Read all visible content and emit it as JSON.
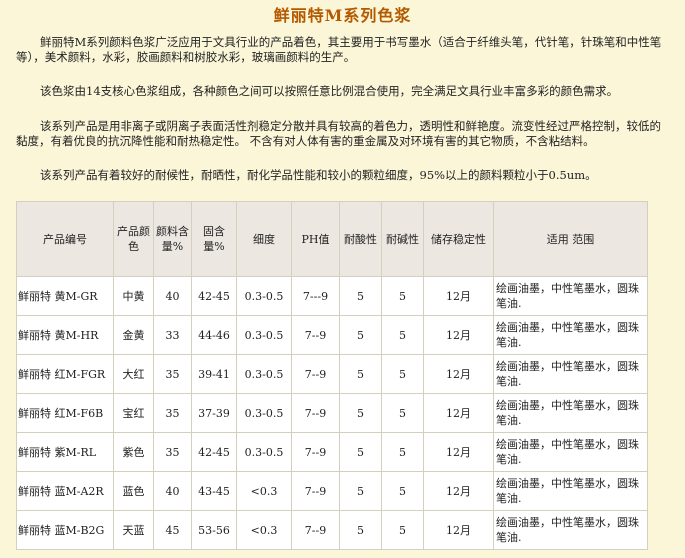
{
  "title": "鲜丽特M系列色浆",
  "paragraphs": [
    "鲜丽特M系列颜料色浆广泛应用于文具行业的产品着色，其主要用于书写墨水（适合于纤维头笔，代针笔，针珠笔和中性笔等），美术颜料，水彩，胶画颜料和树胶水彩，玻璃画颜料的生产。",
    "该色浆由14支核心色浆组成，各种颜色之间可以按照任意比例混合使用，完全满足文具行业丰富多彩的颜色需求。",
    "该系列产品是用非离子或阴离子表面活性剂稳定分散并具有较高的着色力，透明性和鲜艳度。流变性经过严格控制，较低的黏度，有着优良的抗沉降性能和耐热稳定性。 不含有对人体有害的重金属及对环境有害的其它物质，不含粘结料。",
    "该系列产品有着较好的耐候性，耐晒性，耐化学品性能和较小的颗粒细度，95%以上的颜料颗粒小于0.5um。"
  ],
  "table": {
    "headers": [
      "产品编号",
      "产品颜色",
      "颜料含量%",
      "固含量%",
      "细度",
      "PH值",
      "耐酸性",
      "耐碱性",
      "储存稳定性",
      "适用  范围"
    ],
    "rows": [
      {
        "code": "鲜丽特  黄M-GR",
        "color": "中黄",
        "pigment": "40",
        "solid": "42-45",
        "fineness": "0.3-0.5",
        "ph": "7---9",
        "acid": "5",
        "alkali": "5",
        "storage": "12月",
        "usage": "绘画油墨，中性笔墨水，圆珠笔油."
      },
      {
        "code": "鲜丽特  黄M-HR",
        "color": "金黄",
        "pigment": "33",
        "solid": "44-46",
        "fineness": "0.3-0.5",
        "ph": "7--9",
        "acid": "5",
        "alkali": "5",
        "storage": "12月",
        "usage": "绘画油墨，中性笔墨水，圆珠笔油."
      },
      {
        "code": "鲜丽特  红M-FGR",
        "color": "大红",
        "pigment": "35",
        "solid": "39-41",
        "fineness": "0.3-0.5",
        "ph": "7--9",
        "acid": "5",
        "alkali": "5",
        "storage": "12月",
        "usage": "绘画油墨，中性笔墨水，圆珠笔油."
      },
      {
        "code": "鲜丽特  红M-F6B",
        "color": "宝红",
        "pigment": "35",
        "solid": "37-39",
        "fineness": "0.3-0.5",
        "ph": "7--9",
        "acid": "5",
        "alkali": "5",
        "storage": "12月",
        "usage": "绘画油墨，中性笔墨水，圆珠笔油."
      },
      {
        "code": "鲜丽特  紫M-RL",
        "color": "紫色",
        "pigment": "35",
        "solid": "42-45",
        "fineness": "0.3-0.5",
        "ph": "7--9",
        "acid": "5",
        "alkali": "5",
        "storage": "12月",
        "usage": "绘画油墨，中性笔墨水，圆珠笔油."
      },
      {
        "code": "鲜丽特  蓝M-A2R",
        "color": "蓝色",
        "pigment": "40",
        "solid": "43-45",
        "fineness": "<0.3",
        "ph": "7--9",
        "acid": "5",
        "alkali": "5",
        "storage": "12月",
        "usage": "绘画油墨，中性笔墨水，圆珠笔油."
      },
      {
        "code": "鲜丽特  蓝M-B2G",
        "color": "天蓝",
        "pigment": "45",
        "solid": "53-56",
        "fineness": "<0.3",
        "ph": "7--9",
        "acid": "5",
        "alkali": "5",
        "storage": "12月",
        "usage": "绘画油墨，中性笔墨水，圆珠笔油."
      }
    ]
  },
  "colors": {
    "background": "#fbf6d8",
    "title": "#b35a00",
    "header_bg": "#ede7e1",
    "border": "#d4cfbf"
  }
}
